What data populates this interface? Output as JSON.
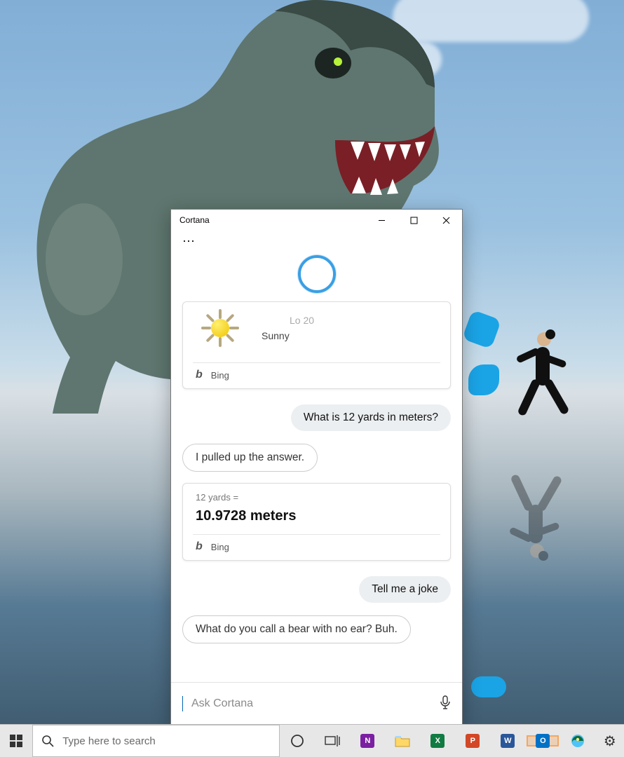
{
  "window": {
    "title": "Cortana",
    "menu": "···"
  },
  "weather": {
    "lo": "Lo 20",
    "condition": "Sunny",
    "source": "Bing"
  },
  "chat": {
    "user1": "What is 12 yards in meters?",
    "assistant1": "I pulled up the answer.",
    "conversion_q": "12 yards =",
    "conversion_a": "10.9728 meters",
    "conversion_source": "Bing",
    "user2": "Tell me a joke",
    "assistant2": "What do you call a bear with no ear? Buh."
  },
  "input": {
    "placeholder": "Ask Cortana"
  },
  "taskbar": {
    "search_placeholder": "Type here to search",
    "apps": {
      "onenote": "N",
      "excel": "X",
      "powerpoint": "P",
      "word": "W",
      "outlook": "O"
    }
  }
}
